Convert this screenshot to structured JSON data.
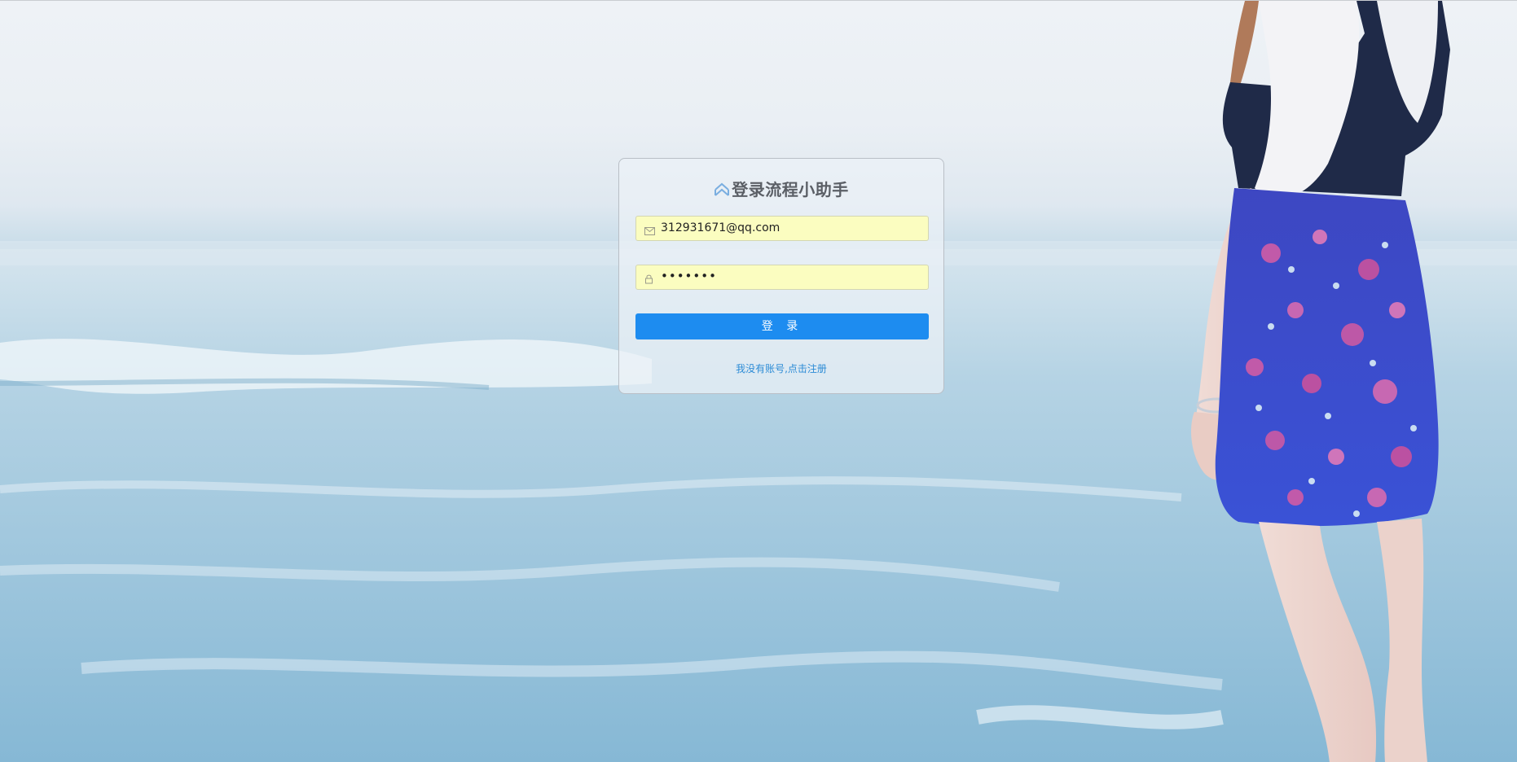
{
  "login": {
    "title": "登录流程小助手",
    "title_icon": "double-chevron-up-icon",
    "email": {
      "icon": "mail-icon",
      "value": "312931671@qq.com"
    },
    "password": {
      "icon": "lock-icon",
      "value": "•••••••"
    },
    "submit_label": "登 录",
    "register_link": "我没有账号,点击注册"
  },
  "colors": {
    "button": "#1d8cf0",
    "link": "#2d8cd6",
    "field_autofill": "#fbfdc0",
    "title_icon": "#7aaee0"
  }
}
